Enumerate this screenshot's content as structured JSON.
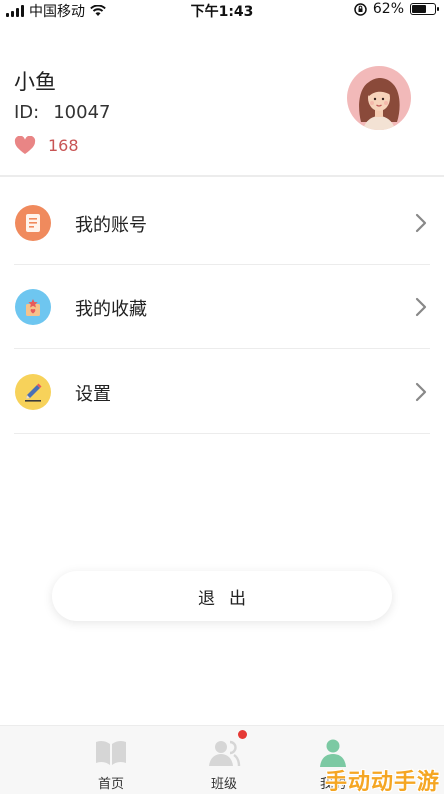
{
  "status_bar": {
    "carrier": "中国移动",
    "time": "下午1:43",
    "battery": "62%",
    "battery_level": 0.62
  },
  "profile": {
    "name": "小鱼",
    "id_label": "ID:",
    "id_value": "10047",
    "likes": "168",
    "heart_color": "#e98585"
  },
  "menu": [
    {
      "label": "我的账号",
      "icon": "account-doc-icon",
      "color": "#f08a5d"
    },
    {
      "label": "我的收藏",
      "icon": "favorites-gift-icon",
      "color": "#6ec6f0"
    },
    {
      "label": "设置",
      "icon": "settings-pencil-icon",
      "color": "#f7d25a"
    }
  ],
  "logout_label": "退出",
  "tabs": [
    {
      "label": "首页",
      "icon": "book-icon",
      "active": false
    },
    {
      "label": "班级",
      "icon": "class-people-icon",
      "active": false,
      "badge": true
    },
    {
      "label": "我的",
      "icon": "person-icon",
      "active": true
    }
  ],
  "accent_color": "#7cc9a3",
  "watermark": "手动动手游"
}
